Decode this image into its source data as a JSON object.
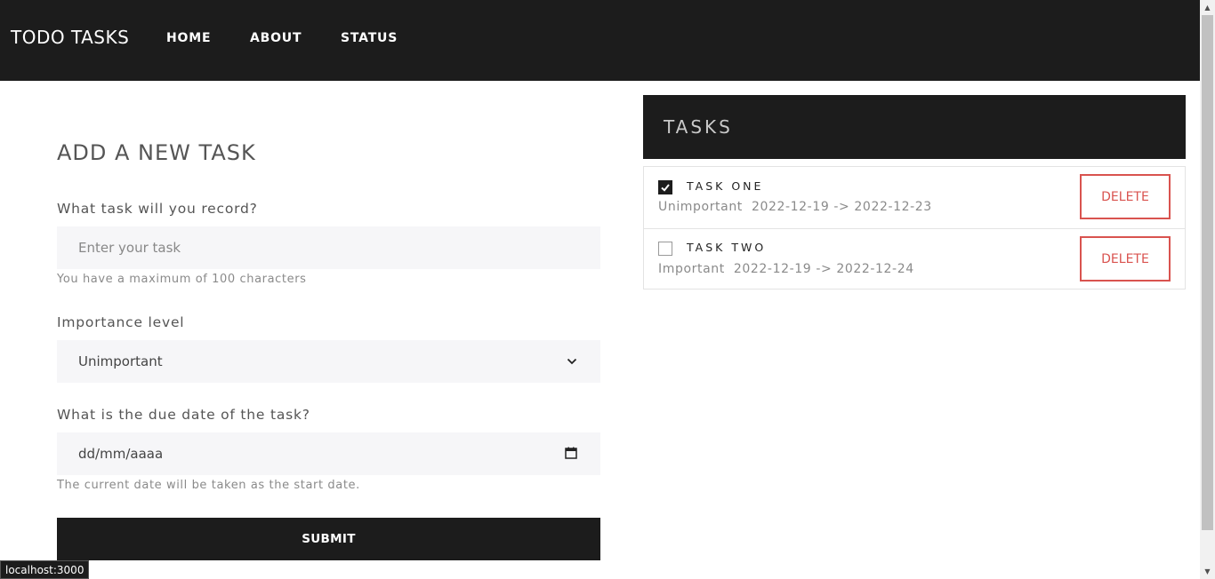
{
  "nav": {
    "brand": "TODO TASKS",
    "links": [
      "HOME",
      "ABOUT",
      "STATUS"
    ]
  },
  "form": {
    "title": "ADD A NEW TASK",
    "task_label": "What task will you record?",
    "task_placeholder": "Enter your task",
    "task_hint": "You have a maximum of 100 characters",
    "importance_label": "Importance level",
    "importance_value": "Unimportant",
    "due_label": "What is the due date of the task?",
    "due_placeholder": "dd/mm/aaaa",
    "due_hint": "The current date will be taken as the start date.",
    "submit_label": "SUBMIT"
  },
  "tasks": {
    "title": "TASKS",
    "items": [
      {
        "name": "TASK ONE",
        "meta": "Unimportant  2022-12-19 -> 2022-12-23",
        "checked": true,
        "delete_label": "DELETE"
      },
      {
        "name": "TASK TWO",
        "meta": "Important  2022-12-19 -> 2022-12-24",
        "checked": false,
        "delete_label": "DELETE"
      }
    ]
  },
  "status_bar": {
    "url": "localhost:3000"
  }
}
